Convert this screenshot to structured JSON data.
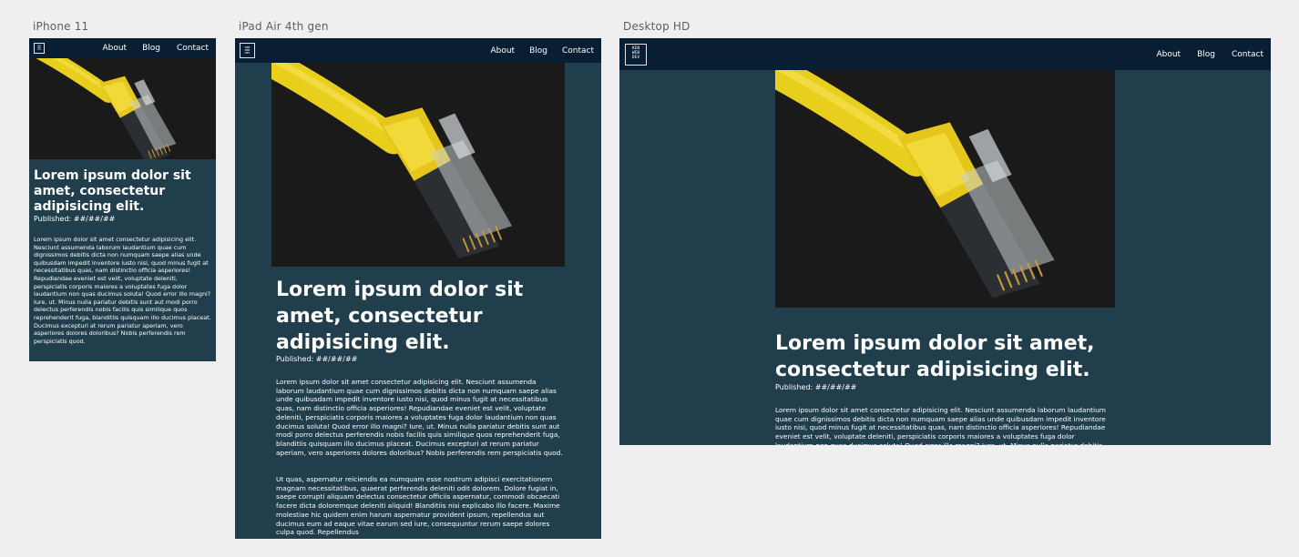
{
  "frames": {
    "iphone": {
      "label": "iPhone 11"
    },
    "ipad": {
      "label": "iPad Air 4th gen"
    },
    "desktop": {
      "label": "Desktop HD"
    }
  },
  "logo": {
    "line1": "KEN",
    "line2": "WEB",
    "line3": "DEV"
  },
  "nav": {
    "about": "About",
    "blog": "Blog",
    "contact": "Contact"
  },
  "article": {
    "title": "Lorem ipsum dolor sit amet, consectetur adipisicing elit.",
    "published": "Published: ##/##/##",
    "paragraph1": "Lorem ipsum dolor sit amet consectetur adipisicing elit. Nesciunt assumenda laborum laudantium quae cum dignissimos debitis dicta non numquam saepe alias unde quibusdam impedit inventore iusto nisi, quod minus fugit at necessitatibus quas, nam distinctio officia asperiores! Repudiandae eveniet est velit, voluptate deleniti, perspiciatis corporis maiores a voluptates fuga dolor laudantium non quas ducimus soluta! Quod error illo magni? Iure, ut. Minus nulla pariatur debitis sunt aut modi porro delectus perferendis nobis facilis quis similique quos reprehenderit fuga, blanditiis quisquam illo ducimus placeat. Ducimus excepturi at rerum pariatur aperiam, vero asperiores dolores doloribus? Nobis perferendis rem perspiciatis quod.",
    "paragraph2": "Ut quas, aspernatur reiciendis ea numquam esse nostrum adipisci exercitationem magnam necessitatibus, quaerat perferendis deleniti odit dolorem. Dolore fugiat in, saepe corrupti aliquam delectus consectetur officiis aspernatur, commodi obcaecati facere dicta doloremque deleniti aliquid! Blanditiis nisi explicabo illo facere. Maxime molestiae hic quidem enim harum aspernatur provident ipsum, repellendus aut ducimus eum ad eaque vitae earum sed iure, consequuntur rerum saepe dolores culpa quod. Repellendus"
  },
  "colors": {
    "canvas": "#efefef",
    "page": "#203e4b",
    "nav": "#0a1e33",
    "cable": "#f0d41c"
  },
  "icons": {
    "hero": "ethernet-cable-photo",
    "logo": "kenwebdev-logo"
  }
}
